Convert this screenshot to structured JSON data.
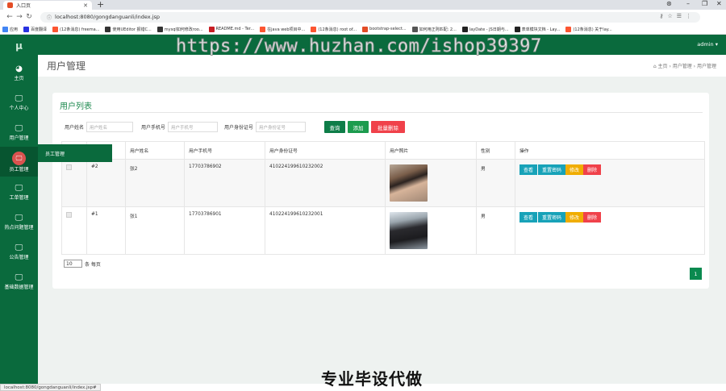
{
  "browser": {
    "tab_title": "入口页",
    "tab_close": "✕",
    "new_tab": "+",
    "url": "localhost:8080/gongdanguanli/index.jsp",
    "bookmarks": [
      {
        "label": "应用",
        "color": "#4285f4"
      },
      {
        "label": "百度翻译",
        "color": "#2932e1"
      },
      {
        "label": "(12条消息) freema...",
        "color": "#fc5531"
      },
      {
        "label": "使用UEditor 报错C...",
        "color": "#333333"
      },
      {
        "label": "mysql如何修改roo...",
        "color": "#333333"
      },
      {
        "label": "README.md - Ter...",
        "color": "#c71d23"
      },
      {
        "label": "在java web项目中...",
        "color": "#fc5531"
      },
      {
        "label": "(12条消息) root of...",
        "color": "#fc5531"
      },
      {
        "label": "bootstrap-select...",
        "color": "#e34c26"
      },
      {
        "label": "如何用正则匹配: 2...",
        "color": "#555555"
      },
      {
        "label": "layDate - JS日期与...",
        "color": "#222222"
      },
      {
        "label": "表单模块文档 - Lay...",
        "color": "#222222"
      },
      {
        "label": "(12条消息) 关于lay...",
        "color": "#fc5531"
      }
    ]
  },
  "sidebar": {
    "brand": "μ",
    "items": [
      {
        "label": "主页",
        "icon": "dashboard-icon",
        "glyph": "◕"
      },
      {
        "label": "个人中心",
        "icon": "monitor-icon",
        "glyph": "🖵"
      },
      {
        "label": "用户管理",
        "icon": "monitor-icon",
        "glyph": "🖵"
      },
      {
        "label": "员工管理",
        "icon": "monitor-icon",
        "glyph": "🖵"
      },
      {
        "label": "工单管理",
        "icon": "monitor-icon",
        "glyph": "🖵"
      },
      {
        "label": "热点问题管理",
        "icon": "monitor-icon",
        "glyph": "🖵"
      },
      {
        "label": "公告管理",
        "icon": "monitor-icon",
        "glyph": "🖵"
      },
      {
        "label": "基础数据管理",
        "icon": "monitor-icon",
        "glyph": "🖵"
      }
    ]
  },
  "popup": {
    "label": "员工管理"
  },
  "header": {
    "user": "admin ▾"
  },
  "page": {
    "title": "用户管理",
    "breadcrumb": "⌂ 主页  ›  用户管理  ›  用户管理"
  },
  "watermark": "https://www.huzhan.com/ishop39397",
  "panel": {
    "title": "用户列表"
  },
  "search": {
    "name_label": "用户姓名",
    "name_placeholder": "用户姓名",
    "phone_label": "用户手机号",
    "phone_placeholder": "用户手机号",
    "id_label": "用户身份证号",
    "id_placeholder": "用户身份证号",
    "query": "查询",
    "add": "添加",
    "batch_delete": "批量删除"
  },
  "table": {
    "headers": [
      "",
      "",
      "用户姓名",
      "用户手机号",
      "用户身份证号",
      "用户照片",
      "性别",
      "操作"
    ],
    "rows": [
      {
        "id": "#2",
        "name": "张2",
        "phone": "17703786902",
        "idcard": "410224199610232002",
        "gender": "男"
      },
      {
        "id": "#1",
        "name": "张1",
        "phone": "17703786901",
        "idcard": "410224199610232001",
        "gender": "男"
      }
    ],
    "actions": {
      "view": "查看",
      "reset": "重置密码",
      "edit": "修改",
      "delete": "删除"
    }
  },
  "pagination": {
    "page_size": "10",
    "per_page_label": "条 每页",
    "current": "1"
  },
  "colors": {
    "primary": "#0a6a3d",
    "view": "#17a2b8",
    "edit": "#f0ad00",
    "delete": "#f0414a",
    "add": "#1c9b4e",
    "query": "#0e7d48"
  },
  "promo": "专业毕设代做",
  "status_url": "localhost:8080/gongdanguanli/index.jsp#"
}
